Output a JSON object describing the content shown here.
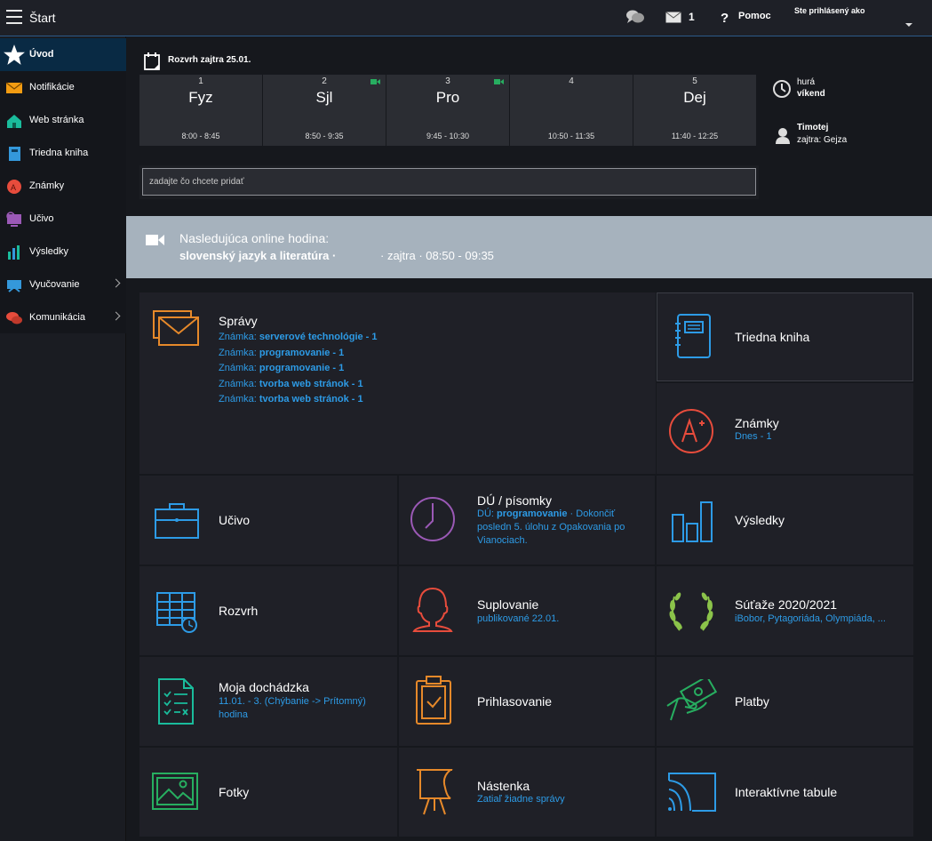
{
  "topbar": {
    "title": "Štart",
    "messages_count": "1",
    "help_label": "Pomoc",
    "user_label": "Ste prihlásený ako"
  },
  "sidebar": {
    "items": [
      {
        "label": "Úvod",
        "icon": "star-icon",
        "color": "#ffffff"
      },
      {
        "label": "Notifikácie",
        "icon": "envelope-icon",
        "color": "#f39c12"
      },
      {
        "label": "Web stránka",
        "icon": "home-icon",
        "color": "#1abc9c"
      },
      {
        "label": "Triedna kniha",
        "icon": "book-icon",
        "color": "#3498db"
      },
      {
        "label": "Známky",
        "icon": "grade-icon",
        "color": "#e74c3c"
      },
      {
        "label": "Učivo",
        "icon": "monitor-icon",
        "color": "#9b59b6"
      },
      {
        "label": "Výsledky",
        "icon": "bar-chart-icon",
        "color": "#1abc9c"
      },
      {
        "label": "Vyučovanie",
        "icon": "classroom-icon",
        "color": "#3498db"
      },
      {
        "label": "Komunikácia",
        "icon": "chat-icon",
        "color": "#e74c3c"
      }
    ]
  },
  "schedule": {
    "title": "Rozvrh zajtra 25.01.",
    "lessons": [
      {
        "num": "1",
        "subject": "Fyz",
        "time": "8:00 - 8:45",
        "online": false
      },
      {
        "num": "2",
        "subject": "Sjl",
        "time": "8:50 - 9:35",
        "online": true
      },
      {
        "num": "3",
        "subject": "Pro",
        "time": "9:45 - 10:30",
        "online": true
      },
      {
        "num": "4",
        "subject": "",
        "time": "10:50 - 11:35",
        "online": false
      },
      {
        "num": "5",
        "subject": "Dej",
        "time": "11:40 - 12:25",
        "online": false
      }
    ],
    "weekend_line1": "hurá",
    "weekend_line2": "víkend",
    "duty_name": "Timotej",
    "duty_next": "zajtra: Gejza"
  },
  "add_input": {
    "placeholder": "zadajte čo chcete pridať"
  },
  "online": {
    "label": "Nasledujúca online hodina:",
    "subject": "slovenský jazyk a literatúra ·",
    "time": "· zajtra · 08:50 - 09:35"
  },
  "tiles": {
    "spravy": {
      "title": "Správy",
      "messages": [
        {
          "prefix": "Známka:",
          "subject": "serverové technológie - 1"
        },
        {
          "prefix": "Známka:",
          "subject": "programovanie - 1"
        },
        {
          "prefix": "Známka:",
          "subject": "programovanie - 1"
        },
        {
          "prefix": "Známka:",
          "subject": "tvorba web stránok - 1"
        },
        {
          "prefix": "Známka:",
          "subject": "tvorba web stránok - 1"
        }
      ]
    },
    "triedna": {
      "title": "Triedna kniha"
    },
    "znamky": {
      "title": "Známky",
      "sub": "Dnes - 1"
    },
    "ucivo": {
      "title": "Učivo"
    },
    "du": {
      "title": "DÚ / písomky",
      "sub_prefix": "DÚ:",
      "sub_subject": "programovanie",
      "sub_rest": "· Dokončiť posledn 5. úlohu z Opakovania po Vianociach."
    },
    "vysledky": {
      "title": "Výsledky"
    },
    "rozvrh": {
      "title": "Rozvrh"
    },
    "suplovanie": {
      "title": "Suplovanie",
      "sub": "publikované 22.01."
    },
    "sutaze": {
      "title": "Súťaže 2020/2021",
      "sub": "iBobor, Pytagoriáda, Olympiáda, ..."
    },
    "dochadzka": {
      "title": "Moja dochádzka",
      "sub": "11.01. - 3. (Chýbanie -> Prítomný) hodina"
    },
    "prihlasovanie": {
      "title": "Prihlasovanie"
    },
    "platby": {
      "title": "Platby"
    },
    "fotky": {
      "title": "Fotky"
    },
    "nastenka": {
      "title": "Nástenka",
      "sub": "Zatiaľ žiadne správy"
    },
    "tabule": {
      "title": "Interaktívne tabule"
    }
  }
}
